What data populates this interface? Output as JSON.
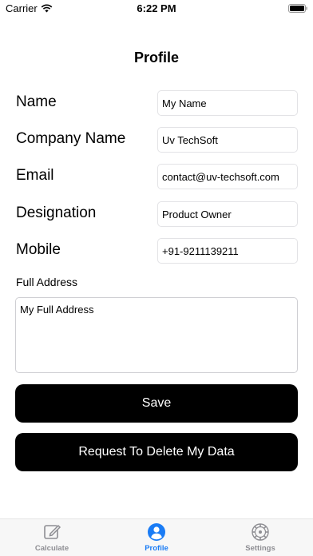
{
  "status_bar": {
    "carrier": "Carrier",
    "time": "6:22 PM"
  },
  "nav": {
    "title": "Profile"
  },
  "fields": [
    {
      "label": "Name",
      "value": "My Name"
    },
    {
      "label": "Company Name",
      "value": "Uv TechSoft"
    },
    {
      "label": "Email",
      "value": "contact@uv-techsoft.com"
    },
    {
      "label": "Designation",
      "value": "Product Owner"
    },
    {
      "label": "Mobile",
      "value": "+91-9211139211"
    }
  ],
  "address": {
    "label": "Full Address",
    "value": "My Full Address"
  },
  "buttons": {
    "save": "Save",
    "delete": "Request To Delete My Data"
  },
  "tabs": [
    {
      "label": "Calculate",
      "icon": "edit-icon"
    },
    {
      "label": "Profile",
      "icon": "person-icon",
      "active": true
    },
    {
      "label": "Settings",
      "icon": "gear-icon"
    }
  ],
  "colors": {
    "accent": "#1a7cf5",
    "button": "#000000",
    "tab_inactive": "#8e8e93"
  }
}
